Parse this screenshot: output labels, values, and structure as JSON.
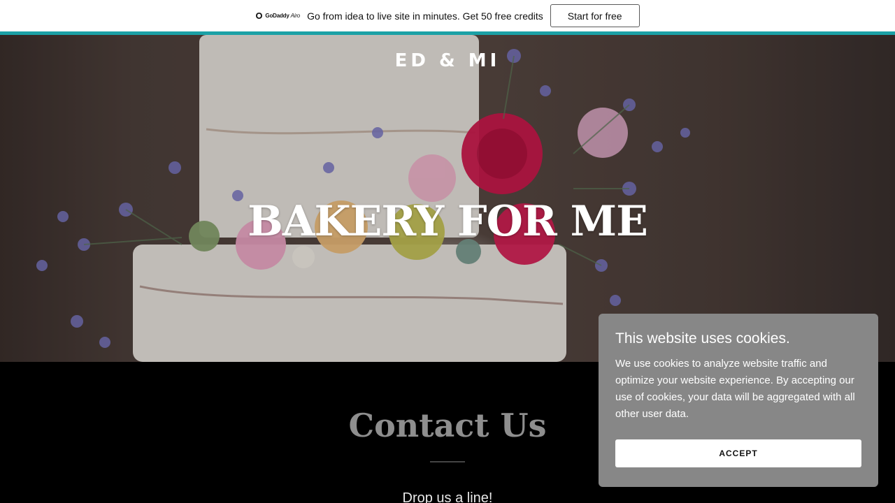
{
  "promo": {
    "brand": "GoDaddy",
    "brand_suffix": "Airo",
    "message": "Go from idea to live site in minutes. Get 50 free credits",
    "cta_label": "Start for free",
    "accent_color": "#1ba1a6"
  },
  "hero": {
    "site_name": "ED & MI",
    "title": "BAKERY FOR ME"
  },
  "contact": {
    "title": "Contact Us",
    "subtitle": "Drop us a line!"
  },
  "cookie_banner": {
    "title": "This website uses cookies.",
    "body": "We use cookies to analyze website traffic and optimize your website experience. By accepting our use of cookies, your data will be aggregated with all other user data.",
    "accept_label": "ACCEPT"
  }
}
